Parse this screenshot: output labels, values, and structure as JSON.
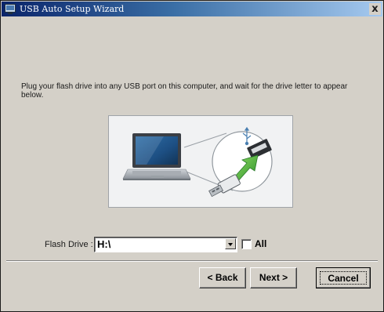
{
  "window": {
    "title": "USB Auto Setup Wizard",
    "close_label": "x"
  },
  "content": {
    "instruction": "Plug your flash drive into any USB port on this computer, and wait for the drive letter to appear below.",
    "illustration_icons": [
      "laptop-icon",
      "usb-plug-icon",
      "usb-symbol-icon",
      "insert-arrow-icon"
    ]
  },
  "drive": {
    "label": "Flash Drive :",
    "value": "H:\\",
    "all_label": "All",
    "all_checked": false
  },
  "buttons": {
    "back": "< Back",
    "next": "Next >",
    "cancel": "Cancel"
  },
  "colors": {
    "title_start": "#0a246a",
    "title_end": "#a6caf0",
    "dialog_bg": "#d4d0c8",
    "arrow_green": "#3aa63a"
  }
}
